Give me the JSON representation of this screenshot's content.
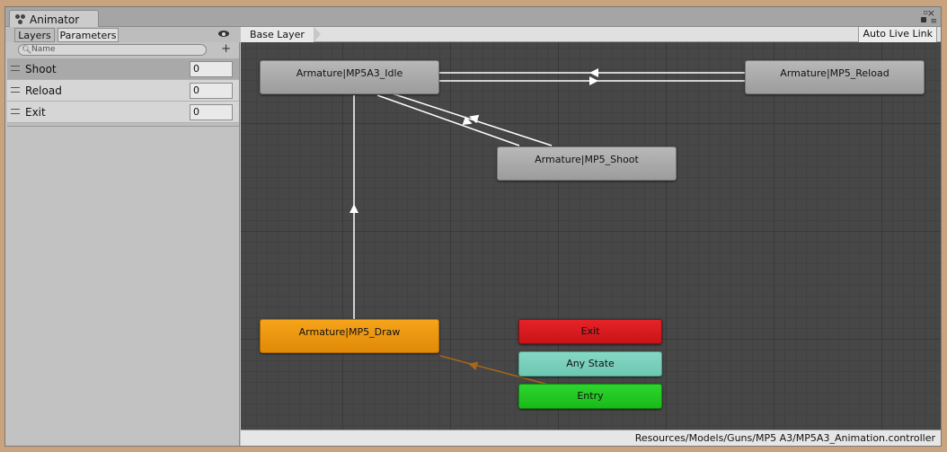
{
  "window": {
    "tab_title": "Animator"
  },
  "left_panel": {
    "tabs": [
      {
        "label": "Layers"
      },
      {
        "label": "Parameters"
      }
    ],
    "search": {
      "placeholder": "Name"
    },
    "add_button": "+",
    "parameters": [
      {
        "name": "Shoot",
        "value": "0",
        "selected": true
      },
      {
        "name": "Reload",
        "value": "0",
        "selected": false
      },
      {
        "name": "Exit",
        "value": "0",
        "selected": false
      }
    ]
  },
  "graph": {
    "breadcrumb": "Base Layer",
    "live_link_label": "Auto Live Link",
    "states": [
      {
        "label": "Armature|MP5A3_Idle",
        "color": "#a8a8a8"
      },
      {
        "label": "Armature|MP5_Reload",
        "color": "#a8a8a8"
      },
      {
        "label": "Armature|MP5_Shoot",
        "color": "#a8a8a8"
      },
      {
        "label": "Armature|MP5_Draw",
        "color": "#ee9810"
      },
      {
        "label": "Exit",
        "color": "#d81c20"
      },
      {
        "label": "Any State",
        "color": "#78cfbc"
      },
      {
        "label": "Entry",
        "color": "#22c922"
      }
    ],
    "default_transition_color": "#a8661a",
    "transition_color": "#ffffff"
  },
  "status": {
    "asset_path": "Resources/Models/Guns/MP5 A3/MP5A3_Animation.controller"
  }
}
